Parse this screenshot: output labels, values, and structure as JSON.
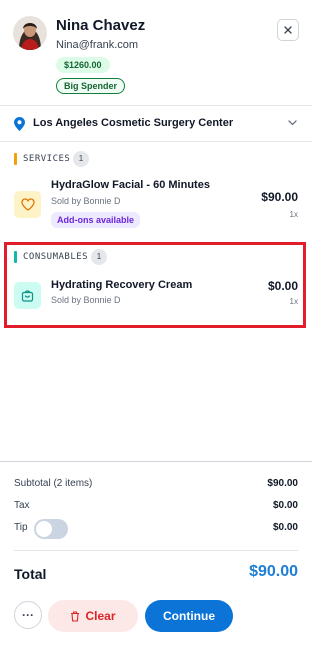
{
  "customer": {
    "name": "Nina Chavez",
    "email": "Nina@frank.com",
    "balance": "$1260.00",
    "tag": "Big Spender"
  },
  "location": {
    "name": "Los Angeles Cosmetic Surgery Center"
  },
  "sections": {
    "services": {
      "title": "SERVICES",
      "count": "1",
      "accent": "#f59e0b",
      "item": {
        "name": "HydraGlow Facial - 60 Minutes",
        "sold_by": "Sold by Bonnie D",
        "addon": "Add-ons available",
        "price": "$90.00",
        "qty": "1x",
        "icon": "heart-icon"
      }
    },
    "consumables": {
      "title": "CONSUMABLES",
      "count": "1",
      "accent": "#14b8a6",
      "item": {
        "name": "Hydrating Recovery Cream",
        "sold_by": "Sold by Bonnie D",
        "price": "$0.00",
        "qty": "1x",
        "icon": "shopping-bag-icon"
      }
    }
  },
  "summary": {
    "subtotal_label": "Subtotal (2 items)",
    "subtotal_value": "$90.00",
    "tax_label": "Tax",
    "tax_value": "$0.00",
    "tip_label": "Tip",
    "tip_value": "$0.00",
    "tip_enabled": false,
    "total_label": "Total",
    "total_value": "$90.00"
  },
  "actions": {
    "more": "···",
    "clear": "Clear",
    "continue": "Continue"
  },
  "colors": {
    "primary": "#0b74d6",
    "danger": "#dc2626",
    "highlight": "#e11d2c"
  }
}
